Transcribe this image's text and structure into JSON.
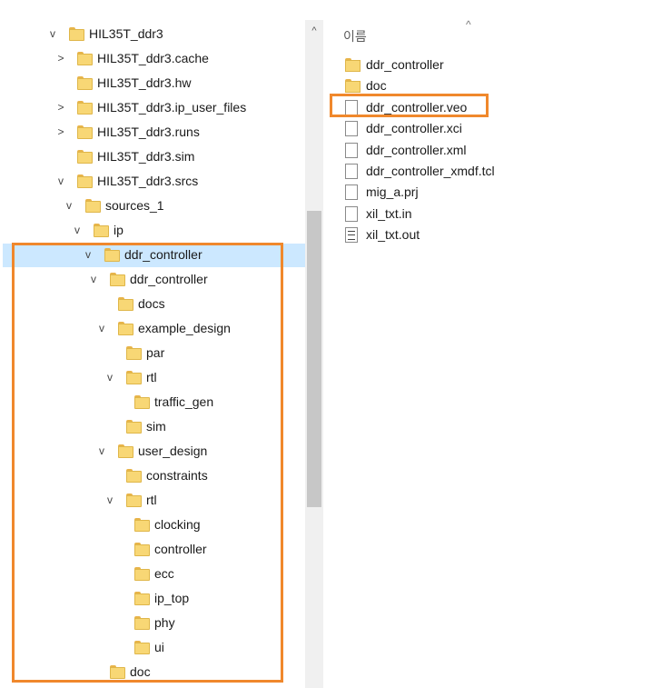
{
  "tree": [
    {
      "label": "HIL35T_ddr3",
      "chevron": "v"
    },
    {
      "label": "HIL35T_ddr3.cache",
      "chevron": ">"
    },
    {
      "label": "HIL35T_ddr3.hw",
      "chevron": ""
    },
    {
      "label": "HIL35T_ddr3.ip_user_files",
      "chevron": ">"
    },
    {
      "label": "HIL35T_ddr3.runs",
      "chevron": ">"
    },
    {
      "label": "HIL35T_ddr3.sim",
      "chevron": ""
    },
    {
      "label": "HIL35T_ddr3.srcs",
      "chevron": "v"
    },
    {
      "label": "sources_1",
      "chevron": "v"
    },
    {
      "label": "ip",
      "chevron": "v"
    },
    {
      "label": "ddr_controller",
      "chevron": "v"
    },
    {
      "label": "ddr_controller",
      "chevron": "v"
    },
    {
      "label": "docs",
      "chevron": ""
    },
    {
      "label": "example_design",
      "chevron": "v"
    },
    {
      "label": "par",
      "chevron": ""
    },
    {
      "label": "rtl",
      "chevron": "v"
    },
    {
      "label": "traffic_gen",
      "chevron": ""
    },
    {
      "label": "sim",
      "chevron": ""
    },
    {
      "label": "user_design",
      "chevron": "v"
    },
    {
      "label": "constraints",
      "chevron": ""
    },
    {
      "label": "rtl",
      "chevron": "v"
    },
    {
      "label": "clocking",
      "chevron": ""
    },
    {
      "label": "controller",
      "chevron": ""
    },
    {
      "label": "ecc",
      "chevron": ""
    },
    {
      "label": "ip_top",
      "chevron": ""
    },
    {
      "label": "phy",
      "chevron": ""
    },
    {
      "label": "ui",
      "chevron": ""
    },
    {
      "label": "doc",
      "chevron": ""
    }
  ],
  "selected_tree_index": 9,
  "scroll_up_arrow": "^",
  "header": {
    "name_column": "이름",
    "sort_arrow": "^"
  },
  "files": [
    {
      "label": "ddr_controller",
      "icon": "folder-icon"
    },
    {
      "label": "doc",
      "icon": "folder-icon"
    },
    {
      "label": "ddr_controller.veo",
      "icon": "file-icon"
    },
    {
      "label": "ddr_controller.xci",
      "icon": "file-icon"
    },
    {
      "label": "ddr_controller.xml",
      "icon": "file-icon"
    },
    {
      "label": "ddr_controller_xmdf.tcl",
      "icon": "file-icon"
    },
    {
      "label": "mig_a.prj",
      "icon": "file-icon"
    },
    {
      "label": "xil_txt.in",
      "icon": "file-icon"
    },
    {
      "label": "xil_txt.out",
      "icon": "text-document-icon"
    }
  ],
  "colors": {
    "highlight": "#f0882c",
    "selection": "#cce8ff",
    "folder": "#f8d775"
  }
}
